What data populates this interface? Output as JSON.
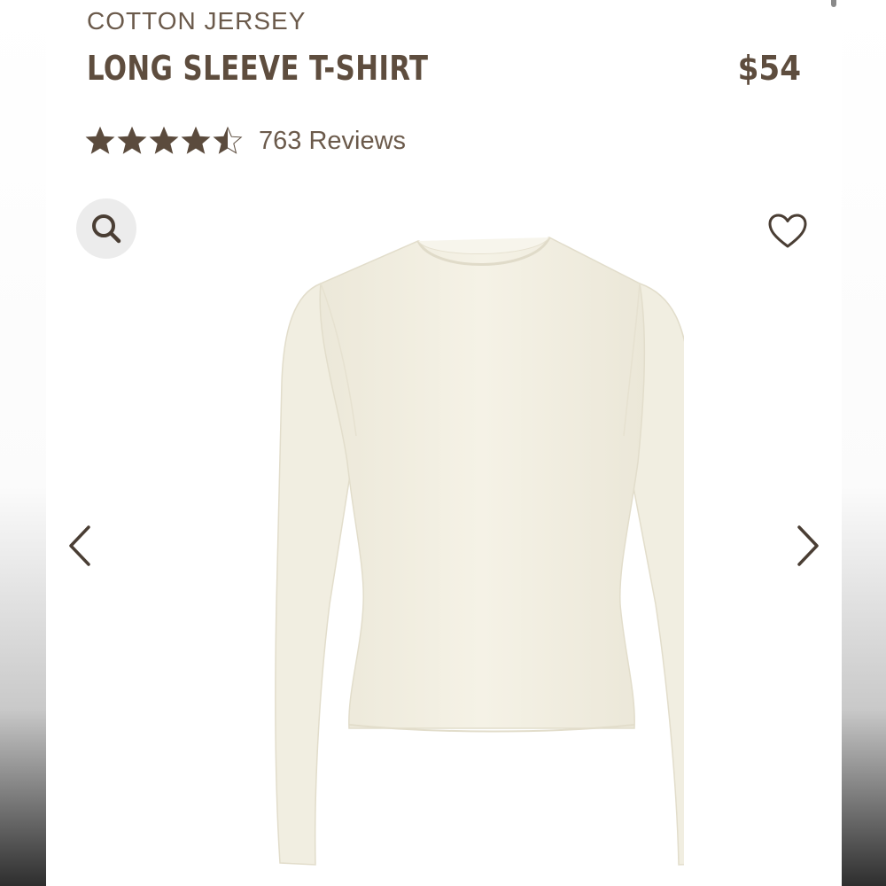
{
  "product": {
    "category": "COTTON JERSEY",
    "title": "LONG SLEEVE T-SHIRT",
    "price": "$54",
    "rating": 4.5,
    "rating_max": 5,
    "reviews_label": "763 Reviews"
  },
  "icons": {
    "search": "search-icon",
    "favorite": "heart-icon",
    "previous": "chevron-left-icon",
    "next": "chevron-right-icon",
    "star": "star-icon"
  },
  "colors": {
    "brand_text": "#5e4d3e",
    "star": "#5b4b3d",
    "garment": "#f3f0e3",
    "search_bg": "#ececec"
  }
}
